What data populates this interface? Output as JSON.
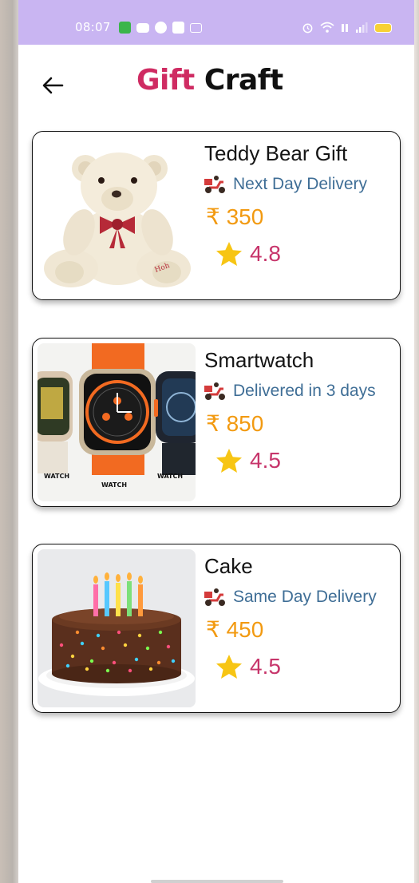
{
  "statusbar": {
    "time": "08:07"
  },
  "header": {
    "title_part1": "Gift",
    "title_part2": "Craft"
  },
  "products": [
    {
      "name": "Teddy Bear Gift",
      "delivery": "Next Day Delivery",
      "price": "₹ 350",
      "rating": "4.8",
      "image": "teddy-bear-image"
    },
    {
      "name": "Smartwatch",
      "delivery": "Delivered in 3 days",
      "price": "₹ 850",
      "rating": "4.5",
      "image": "smartwatch-image",
      "image_labels": [
        "WATCH",
        "WATCH",
        "WATCH"
      ]
    },
    {
      "name": "Cake",
      "delivery": "Same Day Delivery",
      "price": "₹ 450",
      "rating": "4.5",
      "image": "cake-image"
    }
  ],
  "colors": {
    "statusbar": "#c9b5f2",
    "title_accent": "#cf2b62",
    "delivery_text": "#3f6e96",
    "price": "#f29a11",
    "rating": "#c7356b",
    "star": "#f7c514"
  },
  "icons": {
    "back": "arrow-left-icon",
    "delivery": "delivery-scooter-icon",
    "rating": "star-icon"
  }
}
